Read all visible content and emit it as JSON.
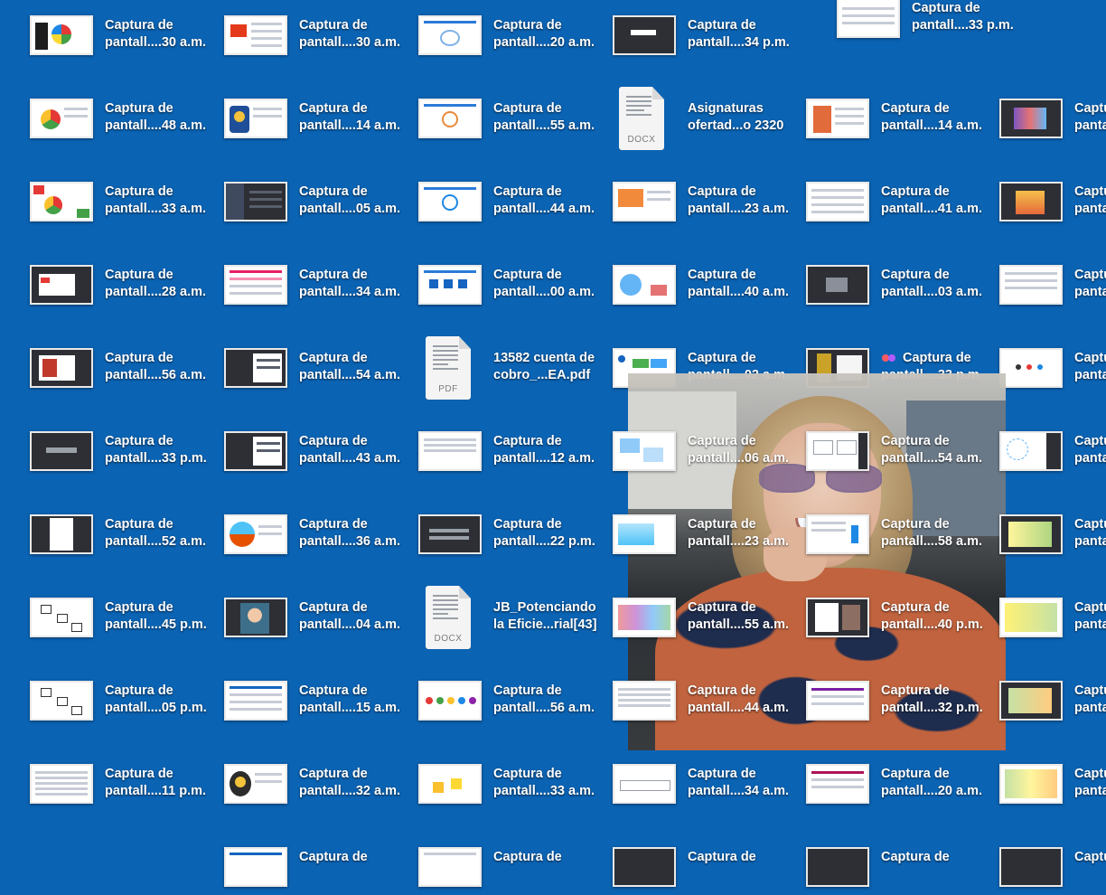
{
  "desktop": {
    "background_color": "#0b63b3",
    "row1": [
      {
        "line1": "Captura de",
        "line2": "pantall....30 a.m."
      },
      {
        "line1": "Captura de",
        "line2": "pantall....30 a.m."
      },
      {
        "line1": "Captura de",
        "line2": "pantall....20 a.m."
      },
      {
        "line1": "Captura de",
        "line2": "pantall....34 p.m."
      },
      {
        "line1": "Captura de",
        "line2": "pantall....33 p.m."
      }
    ],
    "row2": [
      {
        "line1": "Captura de",
        "line2": "pantall....48 a.m."
      },
      {
        "line1": "Captura de",
        "line2": "pantall....14 a.m."
      },
      {
        "line1": "Captura de",
        "line2": "pantall....55 a.m."
      },
      {
        "line1": "Asignaturas",
        "line2": "ofertad...o 2320",
        "doc_type": "DOCX"
      },
      {
        "line1": "Captura de",
        "line2": "pantall....14 a.m."
      },
      {
        "line1": "Captu",
        "line2": "panta"
      }
    ],
    "row3": [
      {
        "line1": "Captura de",
        "line2": "pantall....33 a.m."
      },
      {
        "line1": "Captura de",
        "line2": "pantall....05 a.m."
      },
      {
        "line1": "Captura de",
        "line2": "pantall....44 a.m."
      },
      {
        "line1": "Captura de",
        "line2": "pantall....23 a.m."
      },
      {
        "line1": "Captura de",
        "line2": "pantall....41 a.m."
      },
      {
        "line1": "Captu",
        "line2": "panta"
      }
    ],
    "row4": [
      {
        "line1": "Captura de",
        "line2": "pantall....28 a.m."
      },
      {
        "line1": "Captura de",
        "line2": "pantall....34 a.m."
      },
      {
        "line1": "Captura de",
        "line2": "pantall....00 a.m."
      },
      {
        "line1": "Captura de",
        "line2": "pantall....40 a.m."
      },
      {
        "line1": "Captura de",
        "line2": "pantall....03 a.m."
      },
      {
        "line1": "Captu",
        "line2": "panta"
      }
    ],
    "row5": [
      {
        "line1": "Captura de",
        "line2": "pantall....56 a.m."
      },
      {
        "line1": "Captura de",
        "line2": "pantall....54 a.m."
      },
      {
        "line1": "13582 cuenta de",
        "line2": "cobro_...EA.pdf",
        "doc_type": "PDF"
      },
      {
        "line1": "Captura de",
        "line2": "pantall....02 a.m."
      },
      {
        "line1": "Captura de",
        "line2": "pantall....33 p.m."
      },
      {
        "line1": "Captu",
        "line2": "panta"
      }
    ],
    "row6": [
      {
        "line1": "Captura de",
        "line2": "pantall....33 p.m."
      },
      {
        "line1": "Captura de",
        "line2": "pantall....43 a.m."
      },
      {
        "line1": "Captura de",
        "line2": "pantall....12 a.m."
      },
      {
        "line1": "Captura de",
        "line2": "pantall....06 a.m."
      },
      {
        "line1": "Captura de",
        "line2": "pantall....54 a.m."
      },
      {
        "line1": "Captu",
        "line2": "panta"
      }
    ],
    "row7": [
      {
        "line1": "Captura de",
        "line2": "pantall....52 a.m."
      },
      {
        "line1": "Captura de",
        "line2": "pantall....36 a.m."
      },
      {
        "line1": "Captura de",
        "line2": "pantall....22 p.m."
      },
      {
        "line1": "Captura de",
        "line2": "pantall....23 a.m."
      },
      {
        "line1": "Captura de",
        "line2": "pantall....58 a.m."
      },
      {
        "line1": "Captu",
        "line2": "panta"
      }
    ],
    "row8": [
      {
        "line1": "Captura de",
        "line2": "pantall....45 p.m."
      },
      {
        "line1": "Captura de",
        "line2": "pantall....04 a.m."
      },
      {
        "line1": "JB_Potenciando",
        "line2": "la Eficie...rial[43]",
        "doc_type": "DOCX"
      },
      {
        "line1": "Captura de",
        "line2": "pantall....55 a.m."
      },
      {
        "line1": "Captura de",
        "line2": "pantall....40 p.m."
      },
      {
        "line1": "Captu",
        "line2": "panta"
      }
    ],
    "row9": [
      {
        "line1": "Captura de",
        "line2": "pantall....05 p.m."
      },
      {
        "line1": "Captura de",
        "line2": "pantall....15 a.m."
      },
      {
        "line1": "Captura de",
        "line2": "pantall....56 a.m."
      },
      {
        "line1": "Captura de",
        "line2": "pantall....44 a.m."
      },
      {
        "line1": "Captura de",
        "line2": "pantall....32 p.m."
      },
      {
        "line1": "Captu",
        "line2": "panta"
      }
    ],
    "row10": [
      {
        "line1": "Captura de",
        "line2": "pantall....11 p.m."
      },
      {
        "line1": "Captura de",
        "line2": "pantall....32 a.m."
      },
      {
        "line1": "Captura de",
        "line2": "pantall....33 a.m."
      },
      {
        "line1": "Captura de",
        "line2": "pantall....34 a.m."
      },
      {
        "line1": "Captura de",
        "line2": "pantall....20 a.m."
      },
      {
        "line1": "Captu",
        "line2": "panta"
      }
    ],
    "row11": [
      {
        "line1": "Captura de",
        "line2": ""
      },
      {
        "line1": "Captura de",
        "line2": ""
      },
      {
        "line1": "Captura de",
        "line2": ""
      },
      {
        "line1": "Captura de",
        "line2": ""
      },
      {
        "line1": "Captu",
        "line2": ""
      }
    ]
  },
  "tags": {
    "red": "#ff5a5f",
    "purple": "#b15bff"
  }
}
